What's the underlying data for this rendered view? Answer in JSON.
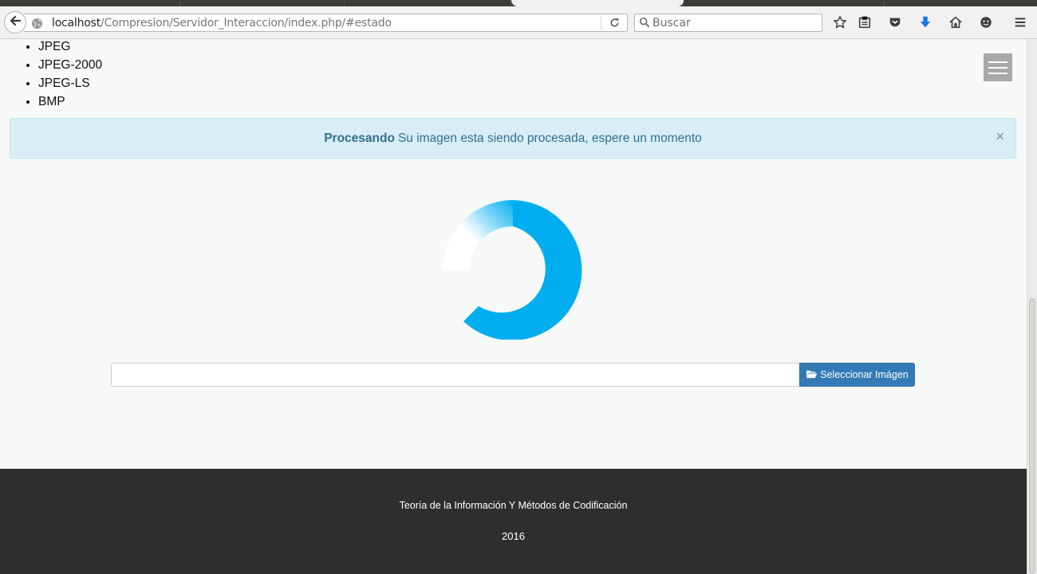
{
  "browser": {
    "url_host": "localhost",
    "url_path": "/Compresion/Servidor_Interaccion/index.php/#estado",
    "search_placeholder": "Buscar"
  },
  "page": {
    "formats": [
      "JPEG",
      "JPEG-2000",
      "JPEG-LS",
      "BMP"
    ],
    "alert": {
      "title": "Procesando",
      "message": "Su imagen esta siendo procesada, espere un momento",
      "close": "×"
    },
    "upload": {
      "file_value": "",
      "button_label": "Seleccionar Imágen"
    },
    "footer": {
      "course": "Teoría de la Información Y Métodos de Codificación",
      "year": "2016"
    }
  },
  "colors": {
    "spinner": "#00aeef",
    "button": "#337ab7",
    "alert_bg": "#d9edf7",
    "footer_bg": "#2e2e2e"
  }
}
